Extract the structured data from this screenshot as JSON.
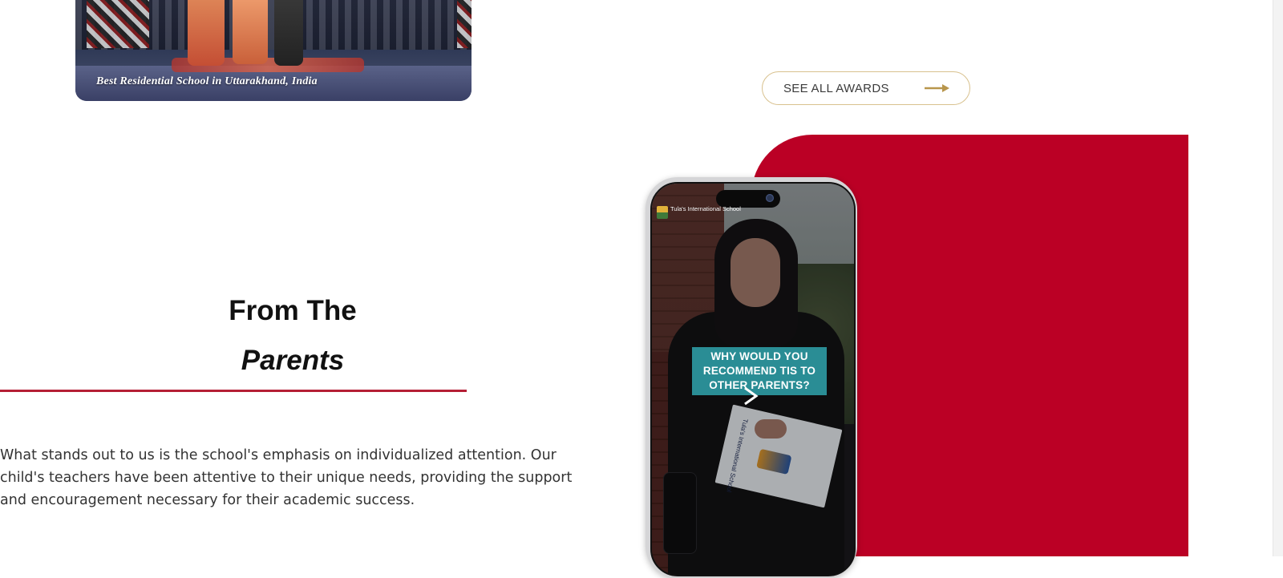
{
  "award": {
    "caption": "Best Residential School in Uttarakhand, India"
  },
  "awards_link": {
    "label": "SEE ALL AWARDS"
  },
  "testimonials": {
    "heading_line1": "From The",
    "heading_line2": "Parents",
    "quote": "What stands out to us is the school's emphasis on individualized attention. Our child's teachers have been attentive to their unique needs, providing the support and encouragement necessary for their academic success."
  },
  "video": {
    "logo_text": "Tula's International School",
    "caption": "WHY WOULD YOU RECOMMEND TIS TO OTHER PARENTS?",
    "brochure_text": "Tula's International School"
  },
  "colors": {
    "accent_red": "#bb0025",
    "divider_red": "#b51f35",
    "button_border_gold": "#d8c18e",
    "arrow_gold": "#b8964c",
    "caption_teal": "#2a8d95"
  },
  "icons": {
    "arrow": "arrow-right-icon",
    "play": "play-icon"
  }
}
